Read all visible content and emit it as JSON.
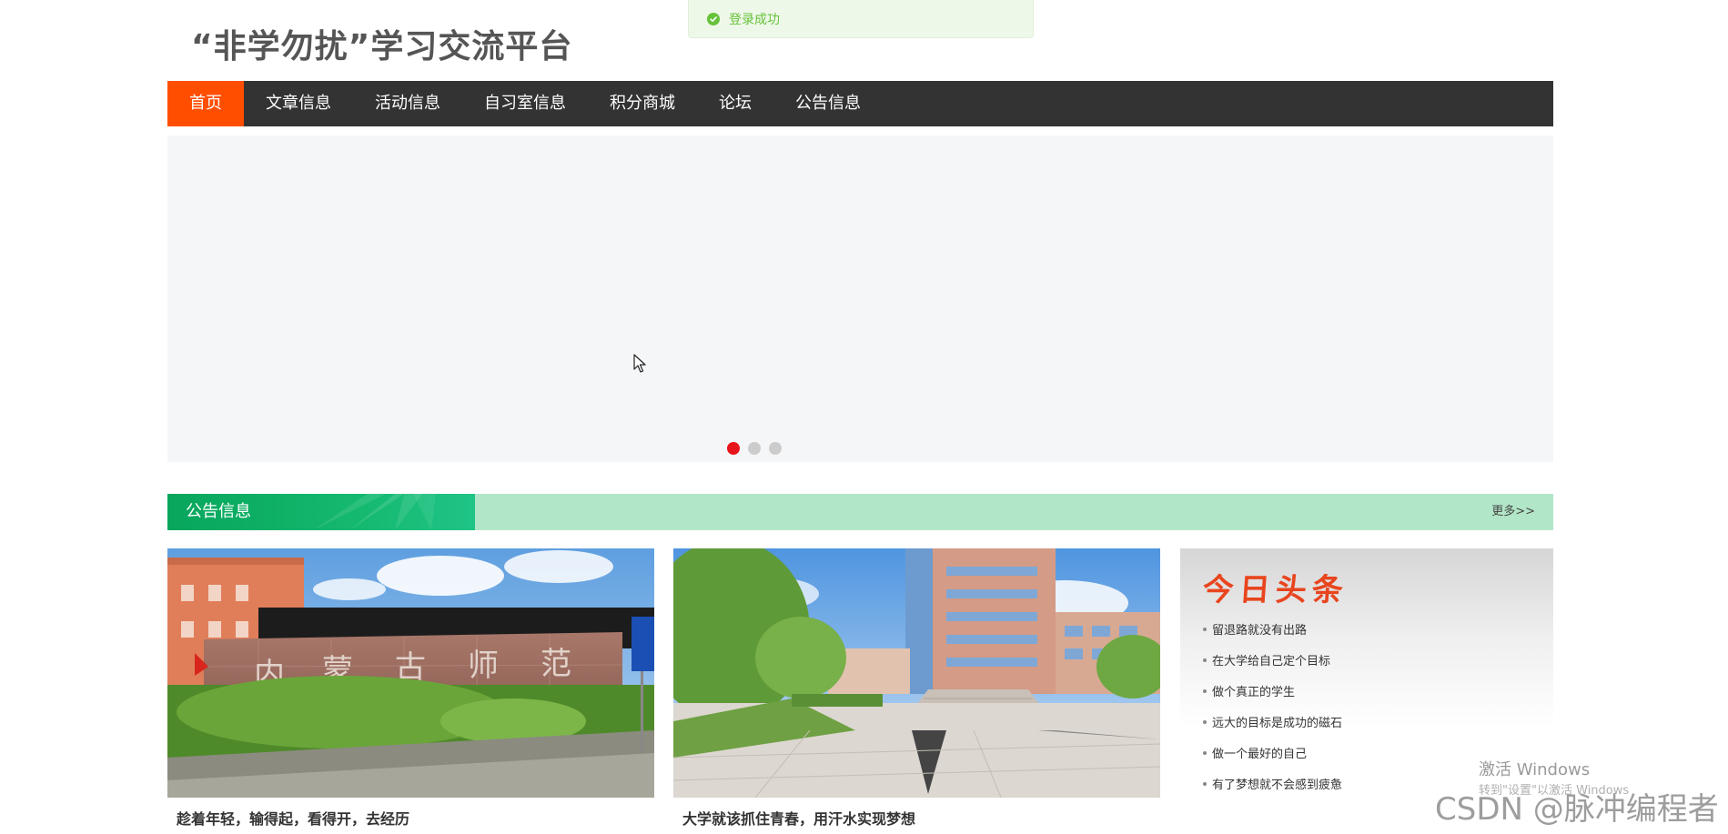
{
  "toast": {
    "icon": "check-circle-icon",
    "message": "登录成功",
    "color": "#67c23a"
  },
  "header": {
    "site_title": "“非学勿扰”学习交流平台"
  },
  "nav": {
    "items": [
      {
        "label": "首页",
        "active": true
      },
      {
        "label": "文章信息",
        "active": false
      },
      {
        "label": "活动信息",
        "active": false
      },
      {
        "label": "自习室信息",
        "active": false
      },
      {
        "label": "积分商城",
        "active": false
      },
      {
        "label": "论坛",
        "active": false
      },
      {
        "label": "公告信息",
        "active": false
      }
    ],
    "active_color": "#ff4e00",
    "bar_color": "#333333"
  },
  "banner": {
    "slide_count": 3,
    "active_slide": 1,
    "active_dot_color": "#e8141b"
  },
  "notice_section": {
    "title": "公告信息",
    "more_link": "更多>>"
  },
  "cards": [
    {
      "caption": "趁着年轻，输得起，看得开，去经历"
    },
    {
      "caption": "大学就该抓住青春，用汗水实现梦想"
    }
  ],
  "headlines": {
    "title": "今日头条",
    "items": [
      "留退路就没有出路",
      "在大学给自己定个目标",
      "做个真正的学生",
      "远大的目标是成功的磁石",
      "做一个最好的自己",
      "有了梦想就不会感到疲惫"
    ]
  },
  "watermarks": {
    "windows_activate": "激活 Windows",
    "windows_activate_sub": "转到\"设置\"以激活 Windows",
    "csdn": "CSDN @脉冲编程者"
  }
}
